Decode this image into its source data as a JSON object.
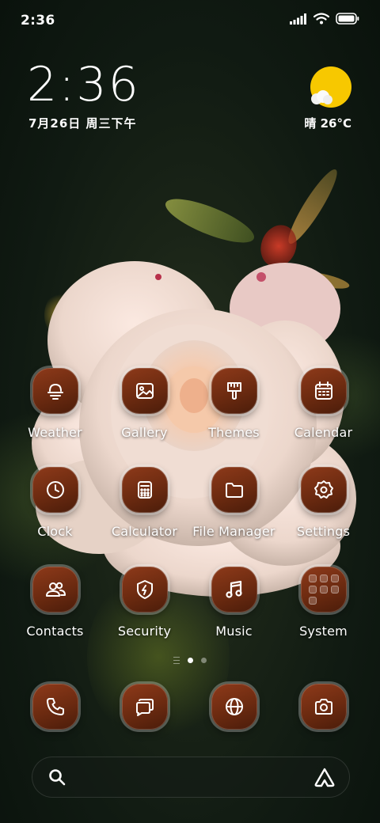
{
  "status_bar": {
    "time": "2:36",
    "icons": [
      "signal-icon",
      "wifi-icon",
      "battery-icon"
    ]
  },
  "clock_widget": {
    "time": "2:36",
    "date": "7月26日 周三下午"
  },
  "weather_widget": {
    "icon": "sun-cloud-icon",
    "text": "晴 26°C",
    "sun_color": "#f7c800"
  },
  "apps": [
    {
      "label": "Weather",
      "icon": "weather-icon"
    },
    {
      "label": "Gallery",
      "icon": "gallery-icon"
    },
    {
      "label": "Themes",
      "icon": "themes-icon"
    },
    {
      "label": "Calendar",
      "icon": "calendar-icon"
    },
    {
      "label": "Clock",
      "icon": "clock-icon"
    },
    {
      "label": "Calculator",
      "icon": "calculator-icon"
    },
    {
      "label": "File Manager",
      "icon": "folder-icon"
    },
    {
      "label": "Settings",
      "icon": "gear-icon"
    },
    {
      "label": "Contacts",
      "icon": "contacts-icon"
    },
    {
      "label": "Security",
      "icon": "shield-icon"
    },
    {
      "label": "Music",
      "icon": "music-icon"
    },
    {
      "label": "System",
      "icon": "folder-grid-icon"
    }
  ],
  "pager": {
    "pages": 2,
    "active": 1
  },
  "dock": [
    {
      "name": "phone",
      "icon": "phone-icon"
    },
    {
      "name": "messages",
      "icon": "messages-icon"
    },
    {
      "name": "browser",
      "icon": "globe-icon"
    },
    {
      "name": "camera",
      "icon": "camera-icon"
    }
  ],
  "search_bar": {
    "icon": "search-icon",
    "assistant_icon": "assistant-icon"
  },
  "theme": {
    "icon_gradient_top": "#8e3a1a",
    "icon_gradient_bottom": "#4a1c0a"
  }
}
